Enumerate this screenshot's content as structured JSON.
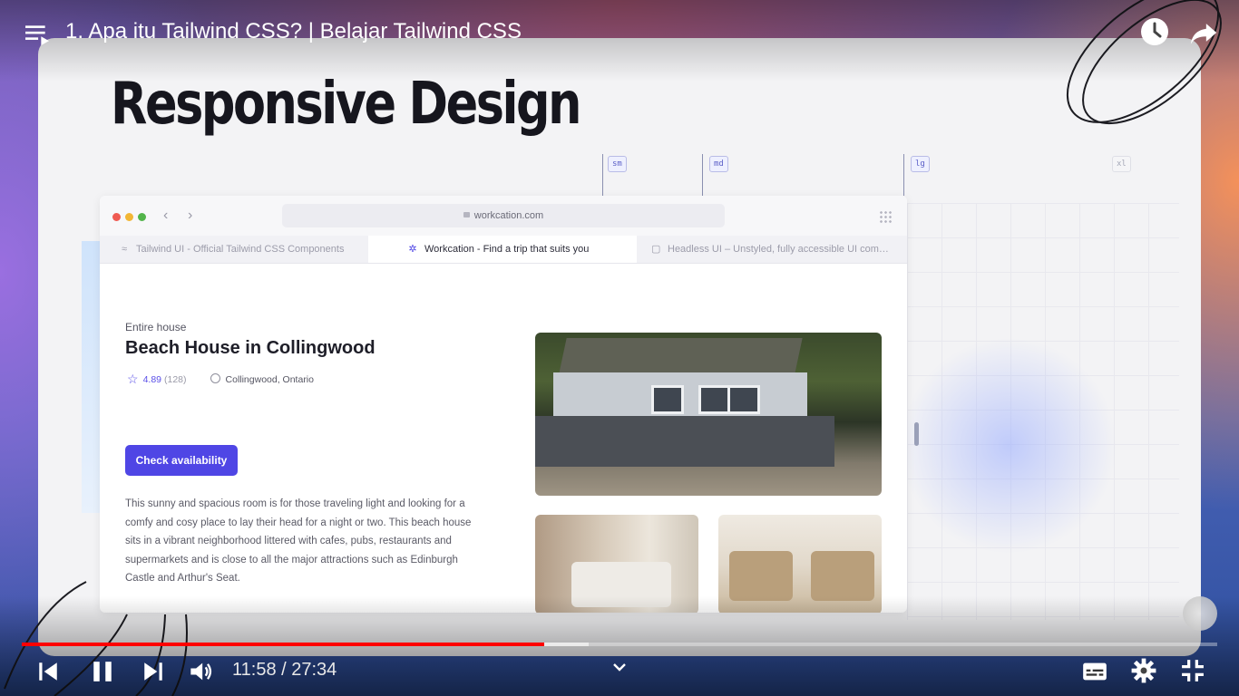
{
  "video": {
    "title": "1. Apa itu Tailwind CSS? | Belajar Tailwind CSS",
    "time_display": "11:58 / 27:34",
    "progress_fraction": 0.4372,
    "buffered_fraction": 0.4742,
    "progress_color": "#ff0000"
  },
  "slide": {
    "title": "Responsive Design",
    "breakpoints": [
      "sm",
      "md",
      "lg",
      "xl"
    ]
  },
  "browser": {
    "url": "workcation.com",
    "tabs": [
      {
        "label": "Tailwind UI - Official Tailwind CSS Components",
        "active": false
      },
      {
        "label": "Workcation - Find a trip that suits you",
        "active": true
      },
      {
        "label": "Headless UI – Unstyled, fully accessible UI com…",
        "active": false
      }
    ]
  },
  "listing": {
    "type": "Entire house",
    "title": "Beach House in Collingwood",
    "rating": "4.89",
    "reviews": "(128)",
    "location": "Collingwood, Ontario",
    "cta": "Check availability",
    "cta_color": "#4f46e5",
    "description": "This sunny and spacious room is for those traveling light and looking for a comfy and cosy place to lay their head for a night or two. This beach house sits in a vibrant neighborhood littered with cafes, pubs, restaurants and supermarkets and is close to all the major attractions such as Edinburgh Castle and Arthur's Seat."
  },
  "icons": {
    "playlist": "playlist-icon",
    "watch_later": "clock-icon",
    "share": "share-icon",
    "prev": "skip-previous-icon",
    "pause": "pause-icon",
    "next": "skip-next-icon",
    "volume": "volume-icon",
    "chevron": "chevron-down-icon",
    "subtitles": "subtitles-icon",
    "settings": "gear-icon",
    "exit_fullscreen": "exit-fullscreen-icon"
  }
}
